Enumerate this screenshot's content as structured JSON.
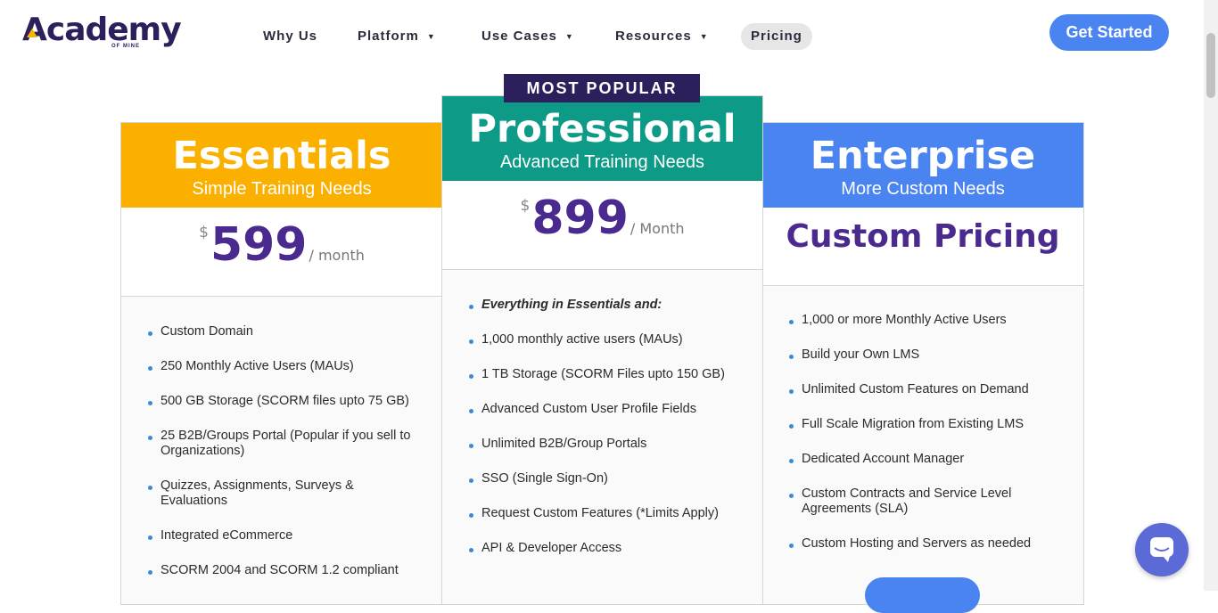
{
  "brand": {
    "name": "Academy",
    "sub": "OF MINE"
  },
  "nav": {
    "items": [
      {
        "label": "Why Us",
        "has_caret": false
      },
      {
        "label": "Platform",
        "has_caret": true
      },
      {
        "label": "Use Cases",
        "has_caret": true
      },
      {
        "label": "Resources",
        "has_caret": true
      },
      {
        "label": "Pricing",
        "has_caret": false,
        "active": true
      }
    ],
    "cta": "Get Started"
  },
  "badge": "MOST POPULAR",
  "plans": {
    "essentials": {
      "title": "Essentials",
      "subtitle": "Simple Training Needs",
      "currency": "$",
      "amount": "599",
      "period": "/ month",
      "color": "#fbb000",
      "features": [
        "Custom Domain",
        "250 Monthly Active Users (MAUs)",
        "500 GB Storage (SCORM files upto 75 GB)",
        "25 B2B/Groups Portal (Popular if you sell to Organizations)",
        "Quizzes, Assignments, Surveys & Evaluations",
        "Integrated eCommerce",
        "SCORM 2004 and SCORM 1.2 compliant"
      ]
    },
    "professional": {
      "title": "Professional",
      "subtitle": "Advanced Training Needs",
      "currency": "$",
      "amount": "899",
      "period": "/ Month",
      "color": "#0d9a86",
      "features": [
        "Everything in Essentials and:",
        "1,000 monthly active users (MAUs)",
        "1 TB Storage (SCORM Files upto 150 GB)",
        "Advanced Custom User Profile Fields",
        "Unlimited B2B/Group Portals",
        "SSO (Single Sign-On)",
        "Request Custom Features (*Limits Apply)",
        "API & Developer Access"
      ]
    },
    "enterprise": {
      "title": "Enterprise",
      "subtitle": "More Custom Needs",
      "price_text": "Custom Pricing",
      "color": "#4a84f1",
      "features": [
        "1,000 or more Monthly Active Users",
        "Build your Own LMS",
        "Unlimited Custom Features on Demand",
        "Full Scale Migration from Existing LMS",
        "Dedicated Account Manager",
        "Custom Contracts and Service Level Agreements (SLA)",
        "Custom Hosting and Servers as needed"
      ]
    }
  },
  "colors": {
    "accent": "#4a84f1",
    "brand": "#2d1f5c",
    "price": "#4a2a8e"
  },
  "icons": {
    "chat": "chat-bubble-icon",
    "caret": "caret-down-icon"
  }
}
